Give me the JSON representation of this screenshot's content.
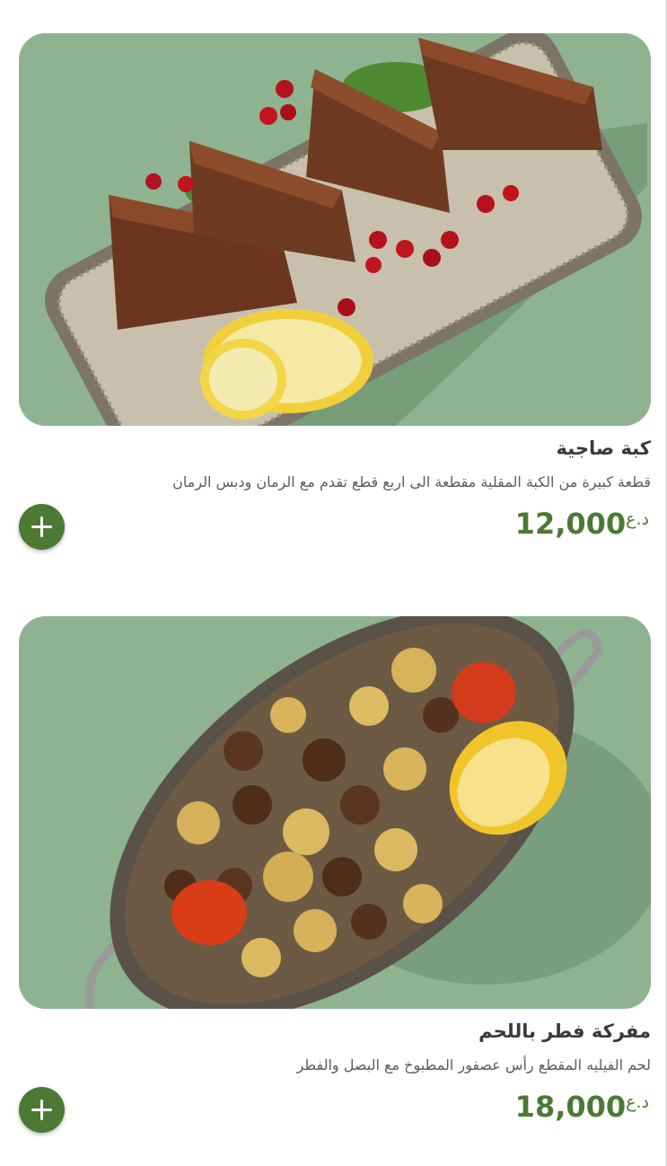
{
  "colors": {
    "accent": "#4c7a34",
    "image_background": "#8fb391",
    "title_text": "#3a3a3a",
    "description_text": "#5c5c5c"
  },
  "icons": {
    "add": "plus-icon"
  },
  "menu_items": [
    {
      "name": "كبة صاجية",
      "description": "قطعة كبيرة من الكبة المقلية مقطعة الى اربع قطع تقدم مع الرمان ودبس الرمان",
      "price": "12,000",
      "currency": "د.ع"
    },
    {
      "name": "مفركة فطر باللحم",
      "description": "لحم الفيليه المقطع رأس عصفور المطبوخ مع البصل والفطر",
      "price": "18,000",
      "currency": "د.ع"
    }
  ]
}
